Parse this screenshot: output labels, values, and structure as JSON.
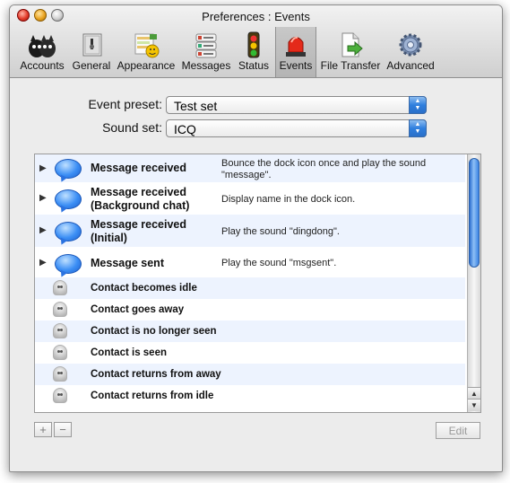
{
  "window": {
    "title": "Preferences : Events"
  },
  "toolbar": {
    "items": [
      {
        "label": "Accounts",
        "icon": "accounts-icon"
      },
      {
        "label": "General",
        "icon": "general-icon"
      },
      {
        "label": "Appearance",
        "icon": "appearance-icon"
      },
      {
        "label": "Messages",
        "icon": "messages-icon"
      },
      {
        "label": "Status",
        "icon": "status-icon"
      },
      {
        "label": "Events",
        "icon": "events-icon",
        "selected": true
      },
      {
        "label": "File Transfer",
        "icon": "file-transfer-icon"
      },
      {
        "label": "Advanced",
        "icon": "advanced-icon"
      }
    ]
  },
  "form": {
    "event_preset_label": "Event preset:",
    "event_preset_value": "Test set",
    "sound_set_label": "Sound set:",
    "sound_set_value": "ICQ"
  },
  "events": [
    {
      "name": "Message received",
      "desc": "Bounce the dock icon once and play the sound \"message\".",
      "icon": "chat-bubble-icon",
      "expandable": true
    },
    {
      "name": "Message received (Background chat)",
      "desc": "Display name in the dock icon.",
      "icon": "chat-bubble-icon",
      "expandable": true
    },
    {
      "name": "Message received (Initial)",
      "desc": "Play the sound \"dingdong\".",
      "icon": "chat-bubble-icon",
      "expandable": true
    },
    {
      "name": "Message sent",
      "desc": "Play the sound \"msgsent\".",
      "icon": "chat-bubble-icon",
      "expandable": true
    },
    {
      "name": "Contact becomes idle",
      "desc": "",
      "icon": "contact-icon",
      "expandable": false
    },
    {
      "name": "Contact goes away",
      "desc": "",
      "icon": "contact-icon",
      "expandable": false
    },
    {
      "name": "Contact is no longer seen",
      "desc": "",
      "icon": "contact-icon",
      "expandable": false
    },
    {
      "name": "Contact is seen",
      "desc": "",
      "icon": "contact-icon",
      "expandable": false
    },
    {
      "name": "Contact returns from away",
      "desc": "",
      "icon": "contact-icon",
      "expandable": false
    },
    {
      "name": "Contact returns from idle",
      "desc": "",
      "icon": "contact-icon",
      "expandable": false
    }
  ],
  "buttons": {
    "add": "+",
    "remove": "−",
    "edit": "Edit"
  },
  "colors": {
    "selection_blue": "#3c8ff5",
    "alt_row": "#edf3fe"
  }
}
